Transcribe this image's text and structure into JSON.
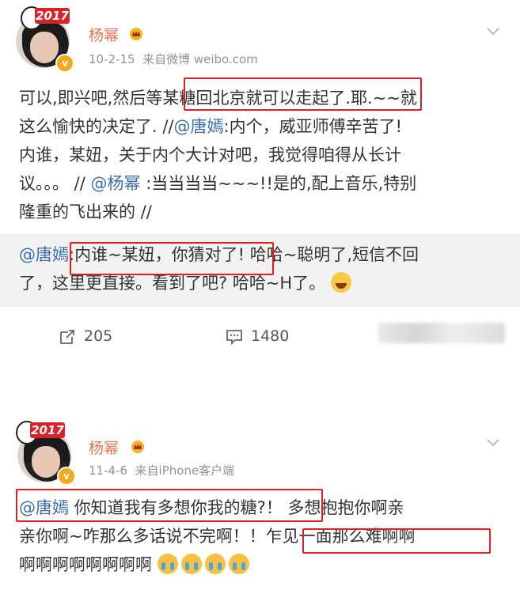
{
  "post1": {
    "author": "杨幂",
    "timestamp": "10-2-15",
    "source": "来自微博 weibo.com",
    "badge_year": "2017",
    "body_lines": [
      "可以,即兴吧,然后等某糖回北京就可以走起了.耶.~~就",
      "这么愉快的决定了. //",
      ":内个，威亚师傅辛苦了!",
      "内谁，某妞，关于内个大计对吧，我觉得咱得从长计",
      "议。。。 //",
      " :当当当当~~~!!是的,配上音乐,特别",
      "隆重的飞出来的 //"
    ],
    "mention_tangyan": "@唐嫣",
    "mention_yangmi": "@杨幂",
    "repost": {
      "mention": "@唐嫣",
      "line1": ":内谁~某妞，你猜对了!  哈哈~聪明了,短信不回",
      "line2": "了，这里更直接。看到了吧? 哈哈~H了。"
    },
    "actions": {
      "repost_count": "205",
      "comment_count": "1480"
    }
  },
  "post2": {
    "author": "杨幂",
    "timestamp": "11-4-6",
    "source": "来自iPhone客户端",
    "badge_year": "2017",
    "mention": "@唐嫣",
    "line1_rest": " 你知道我有多想你我的糖?！ 多想抱抱你啊亲",
    "line2": "亲你啊~咋那么多话说不完啊！！乍见一面那么难啊啊",
    "line3": "啊啊啊啊啊啊啊啊"
  }
}
